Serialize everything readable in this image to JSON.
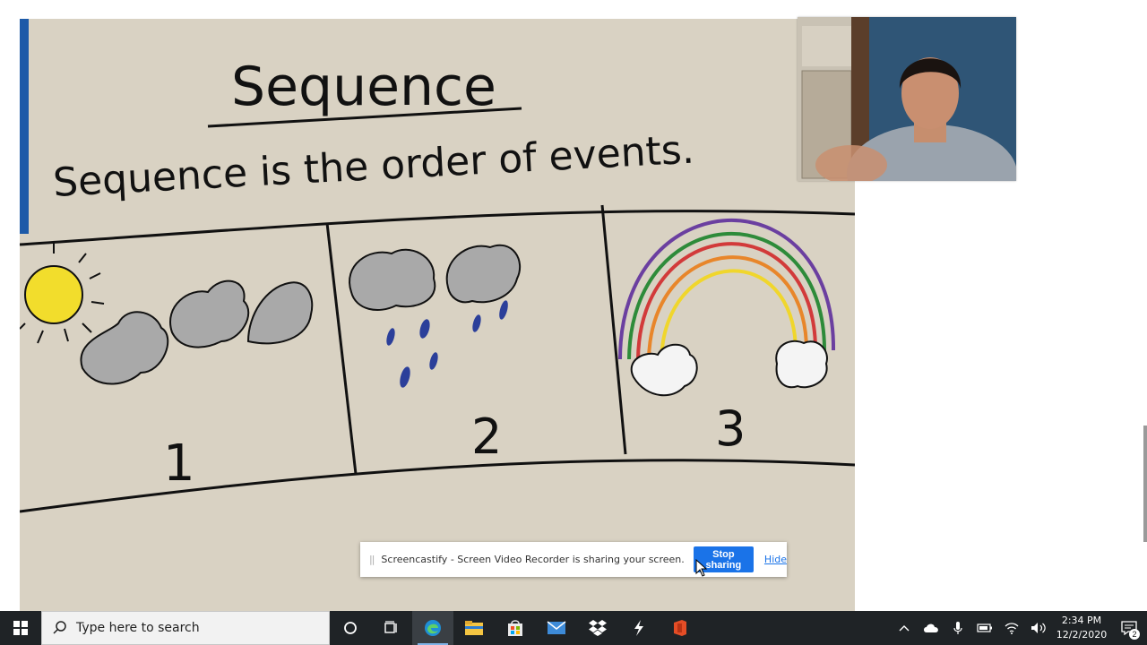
{
  "poster": {
    "title": "Sequence",
    "definition": "Sequence is the order of events.",
    "panels": [
      {
        "number": "1",
        "scene": "sun and clouds"
      },
      {
        "number": "2",
        "scene": "rain clouds"
      },
      {
        "number": "3",
        "scene": "rainbow"
      }
    ]
  },
  "share_bar": {
    "message": "Screencastify - Screen Video Recorder is sharing your screen.",
    "stop_label": "Stop sharing",
    "hide_label": "Hide"
  },
  "taskbar": {
    "search_placeholder": "Type here to search",
    "apps": [
      "cortana-icon",
      "task-view-icon",
      "edge-icon",
      "file-explorer-icon",
      "store-icon",
      "mail-icon",
      "dropbox-icon",
      "screencastify-icon",
      "office-icon"
    ],
    "clock_time": "2:34 PM",
    "clock_date": "12/2/2020",
    "notification_count": "2"
  },
  "colors": {
    "poster_bg": "#d9d2c3",
    "taskbar_bg": "#1f2326",
    "accent": "#1a73e8"
  }
}
